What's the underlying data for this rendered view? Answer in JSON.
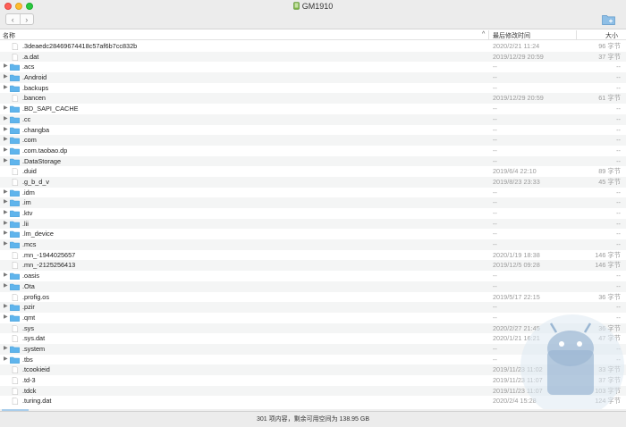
{
  "window": {
    "title": "GM1910"
  },
  "toolbar": {
    "back": "‹",
    "forward": "›"
  },
  "columns": {
    "name": "名称",
    "modified": "最后修改时间",
    "size": "大小",
    "sort_indicator": "^"
  },
  "colors": {
    "folder": "#5fb4ec",
    "folder_dark": "#4a9fd8",
    "alt_row": "#f4f5f5"
  },
  "files": [
    {
      "name": ".3deaedc28469674418c57af6b7cc832b",
      "folder": false,
      "date": "2020/2/21 11:24",
      "size": "96 字节"
    },
    {
      "name": ".a.dat",
      "folder": false,
      "date": "2019/12/29 20:59",
      "size": "37 字节"
    },
    {
      "name": ".acs",
      "folder": true,
      "date": "--",
      "size": "--"
    },
    {
      "name": ".Android",
      "folder": true,
      "date": "--",
      "size": "--"
    },
    {
      "name": ".backups",
      "folder": true,
      "date": "--",
      "size": "--"
    },
    {
      "name": ".bancen",
      "folder": false,
      "date": "2019/12/29 20:59",
      "size": "61 字节"
    },
    {
      "name": ".BD_SAPI_CACHE",
      "folder": true,
      "date": "--",
      "size": "--"
    },
    {
      "name": ".cc",
      "folder": true,
      "date": "--",
      "size": "--"
    },
    {
      "name": ".changba",
      "folder": true,
      "date": "--",
      "size": "--"
    },
    {
      "name": ".com",
      "folder": true,
      "date": "--",
      "size": "--"
    },
    {
      "name": ".com.taobao.dp",
      "folder": true,
      "date": "--",
      "size": "--"
    },
    {
      "name": ".DataStorage",
      "folder": true,
      "date": "--",
      "size": "--"
    },
    {
      "name": ".duid",
      "folder": false,
      "date": "2019/6/4 22:10",
      "size": "89 字节"
    },
    {
      "name": ".g_b_d_v",
      "folder": false,
      "date": "2019/8/23 23:33",
      "size": "45 字节"
    },
    {
      "name": ".idm",
      "folder": true,
      "date": "--",
      "size": "--"
    },
    {
      "name": ".im",
      "folder": true,
      "date": "--",
      "size": "--"
    },
    {
      "name": ".ktv",
      "folder": true,
      "date": "--",
      "size": "--"
    },
    {
      "name": ".lii",
      "folder": true,
      "date": "--",
      "size": "--"
    },
    {
      "name": ".lm_device",
      "folder": true,
      "date": "--",
      "size": "--"
    },
    {
      "name": ".mcs",
      "folder": true,
      "date": "--",
      "size": "--"
    },
    {
      "name": ".mn_-1944025657",
      "folder": false,
      "date": "2020/1/19 18:38",
      "size": "146 字节"
    },
    {
      "name": ".mn_-2125256413",
      "folder": false,
      "date": "2019/12/5 09:28",
      "size": "146 字节"
    },
    {
      "name": ".oasis",
      "folder": true,
      "date": "--",
      "size": "--"
    },
    {
      "name": ".Ota",
      "folder": true,
      "date": "--",
      "size": "--"
    },
    {
      "name": ".profig.os",
      "folder": false,
      "date": "2019/5/17 22:15",
      "size": "36 字节"
    },
    {
      "name": ".pzir",
      "folder": true,
      "date": "--",
      "size": "--"
    },
    {
      "name": ".qmt",
      "folder": true,
      "date": "--",
      "size": "--"
    },
    {
      "name": ".sys",
      "folder": false,
      "date": "2020/2/27 21:45",
      "size": "36 字节"
    },
    {
      "name": ".sys.dat",
      "folder": false,
      "date": "2020/1/21 16:21",
      "size": "47 字节"
    },
    {
      "name": ".system",
      "folder": true,
      "date": "--",
      "size": "--"
    },
    {
      "name": ".tbs",
      "folder": true,
      "date": "--",
      "size": "--"
    },
    {
      "name": ".tcookieid",
      "folder": false,
      "date": "2019/11/23 11:02",
      "size": "33 字节"
    },
    {
      "name": ".td-3",
      "folder": false,
      "date": "2019/11/23 11:07",
      "size": "37 字节"
    },
    {
      "name": ".tdck",
      "folder": false,
      "date": "2019/11/23 11:07",
      "size": "103 字节"
    },
    {
      "name": ".turing.dat",
      "folder": false,
      "date": "2020/2/4 15:28",
      "size": "124 字节"
    }
  ],
  "status": {
    "text": "301 项内容，剩余可用空间为 138.95 GB"
  }
}
